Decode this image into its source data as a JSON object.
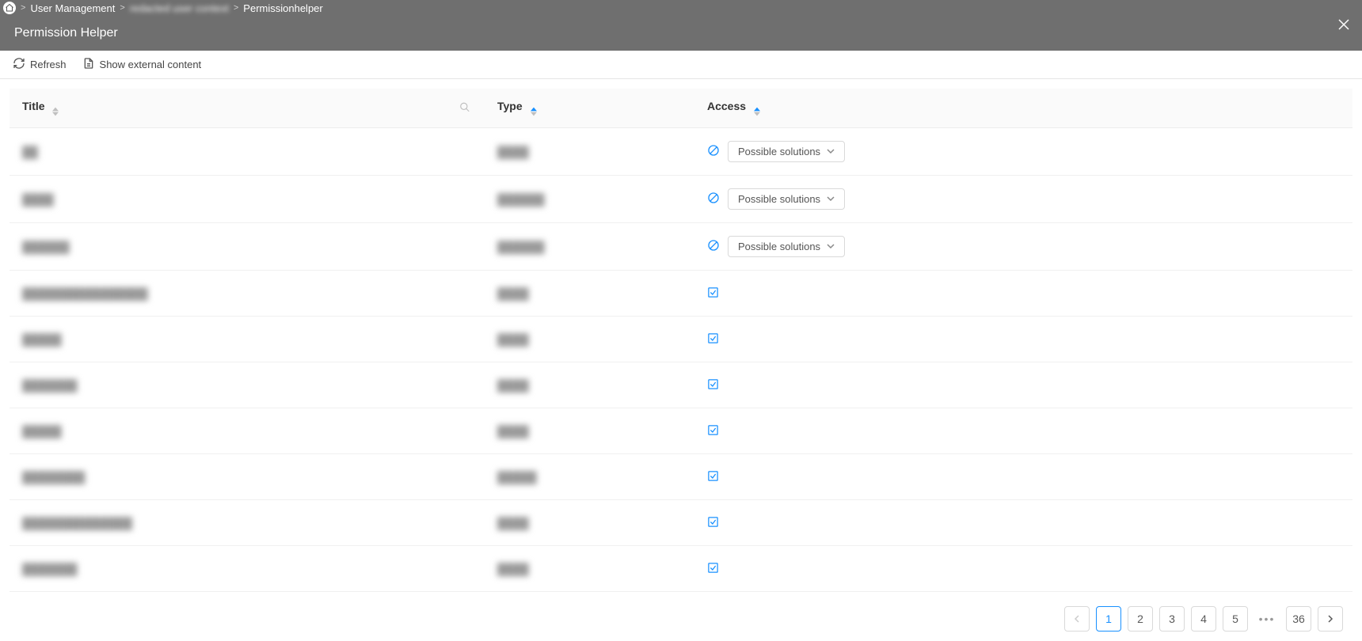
{
  "breadcrumb": {
    "home_icon": "home",
    "items": [
      {
        "label": "User Management"
      },
      {
        "label": "redacted user context",
        "blurred": true
      },
      {
        "label": "Permissionhelper"
      }
    ]
  },
  "header": {
    "title": "Permission Helper"
  },
  "toolbar": {
    "refresh_label": "Refresh",
    "show_external_label": "Show external content"
  },
  "table": {
    "columns": {
      "title": "Title",
      "type": "Type",
      "access": "Access"
    },
    "solutions_button_label": "Possible solutions",
    "rows": [
      {
        "title": "██",
        "type": "████",
        "access": "denied"
      },
      {
        "title": "████",
        "type": "██████",
        "access": "denied"
      },
      {
        "title": "██████",
        "type": "██████",
        "access": "denied"
      },
      {
        "title": "████████████████",
        "type": "████",
        "access": "allowed"
      },
      {
        "title": "█████",
        "type": "████",
        "access": "allowed"
      },
      {
        "title": "███████",
        "type": "████",
        "access": "allowed"
      },
      {
        "title": "█████",
        "type": "████",
        "access": "allowed"
      },
      {
        "title": "████████",
        "type": "█████",
        "access": "allowed"
      },
      {
        "title": "██████████████",
        "type": "████",
        "access": "allowed"
      },
      {
        "title": "███████",
        "type": "████",
        "access": "allowed"
      }
    ]
  },
  "pagination": {
    "prev_disabled": true,
    "pages_shown": [
      "1",
      "2",
      "3",
      "4",
      "5"
    ],
    "active_page": "1",
    "last_page": "36"
  }
}
